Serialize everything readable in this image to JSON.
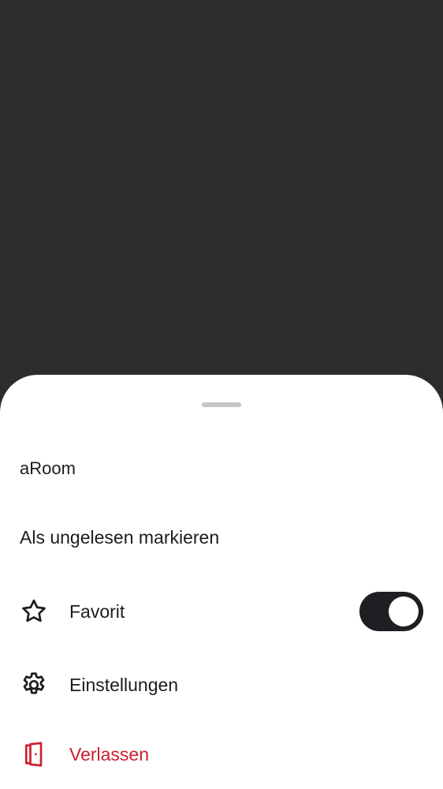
{
  "sheet": {
    "room_name": "aRoom",
    "actions": {
      "mark_unread": {
        "label": "Als ungelesen markieren"
      },
      "favourite": {
        "label": "Favorit",
        "icon": "star-icon",
        "toggle_on": true
      },
      "settings": {
        "label": "Einstellungen",
        "icon": "gear-icon"
      },
      "leave": {
        "label": "Verlassen",
        "icon": "door-exit-icon",
        "color": "#cc1f2e"
      }
    }
  },
  "colors": {
    "scrim": "#2b2c2e",
    "sheet": "#ffffff",
    "text": "#1b1c1f",
    "destructive": "#cc1f2e",
    "toggle_track": "#1e1f22"
  }
}
